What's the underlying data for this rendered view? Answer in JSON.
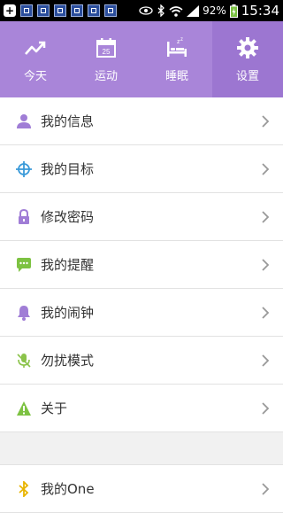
{
  "status": {
    "battery": "92%",
    "time": "15:34"
  },
  "tabs": [
    {
      "label": "今天",
      "icon": "trend-icon"
    },
    {
      "label": "运动",
      "icon": "calendar-icon",
      "badge": "25"
    },
    {
      "label": "睡眠",
      "icon": "bed-icon"
    },
    {
      "label": "设置",
      "icon": "gear-icon"
    }
  ],
  "menu": [
    {
      "label": "我的信息",
      "icon": "user-icon",
      "color": "#a07dd6"
    },
    {
      "label": "我的目标",
      "icon": "target-icon",
      "color": "#3a9ad9"
    },
    {
      "label": "修改密码",
      "icon": "lock-icon",
      "color": "#a07dd6"
    },
    {
      "label": "我的提醒",
      "icon": "chat-icon",
      "color": "#7dc242"
    },
    {
      "label": "我的闹钟",
      "icon": "bell-icon",
      "color": "#a07dd6"
    },
    {
      "label": "勿扰模式",
      "icon": "mic-icon",
      "color": "#8bc34a"
    },
    {
      "label": "关于",
      "icon": "warning-icon",
      "color": "#7dc242"
    }
  ],
  "menu2": [
    {
      "label": "我的One",
      "icon": "bluetooth-icon",
      "color": "#e8b400"
    }
  ]
}
